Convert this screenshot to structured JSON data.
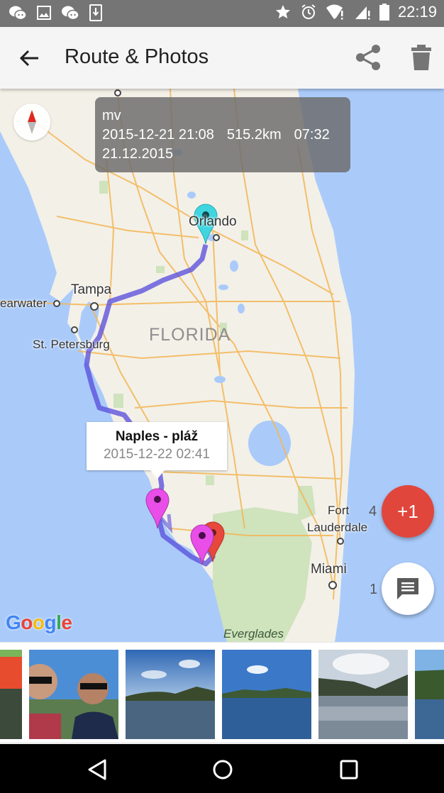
{
  "status_bar": {
    "left_icons": [
      "wechat-icon",
      "gallery-icon",
      "wechat-icon",
      "download-icon"
    ],
    "right_icons": [
      "star-icon",
      "alarm-icon",
      "wifi-alert-icon",
      "signal-alert-icon",
      "battery-icon"
    ],
    "time": "22:19"
  },
  "app_bar": {
    "title": "Route & Photos",
    "back_icon": "arrow-back-icon",
    "actions": [
      "share-icon",
      "delete-icon"
    ]
  },
  "map": {
    "info_box": {
      "name": "mv",
      "start": "2015-12-21 21:08",
      "distance": "515.2km",
      "duration": "07:32",
      "date": "21.12.2015"
    },
    "labels": {
      "orlando": "Orlando",
      "tampa": "Tampa",
      "clearwater": "earwater",
      "st_petersburg": "St. Petersburg",
      "florida": "FLORIDA",
      "fort": "Fort",
      "lauderdale": "Lauderdale",
      "miami": "Miami",
      "everglades": "Everglades"
    },
    "popup": {
      "title": "Naples - pláž",
      "subtitle": "2015-12-22 02:41"
    },
    "fab_plus": {
      "label": "+1",
      "count": "4"
    },
    "fab_comment": {
      "icon": "comment-icon",
      "count": "1"
    },
    "google_logo": [
      "G",
      "o",
      "o",
      "g",
      "l",
      "e"
    ],
    "colors": {
      "water": "#aacbfa",
      "land": "#f3f0e8",
      "route": "#5a4fdc",
      "marker_start": "#3fd6e0",
      "marker_photo": "#e94ee8",
      "marker_end": "#e8473b",
      "fab_red": "#e0463c"
    }
  },
  "photos": {
    "items": [
      {
        "name": "airboat-sign-photo"
      },
      {
        "name": "selfie-photo"
      },
      {
        "name": "lake-photo-1"
      },
      {
        "name": "lake-photo-2"
      },
      {
        "name": "river-photo"
      },
      {
        "name": "trees-photo"
      }
    ]
  },
  "nav_bar": {
    "buttons": [
      "back-nav-icon",
      "home-nav-icon",
      "recents-nav-icon"
    ]
  }
}
